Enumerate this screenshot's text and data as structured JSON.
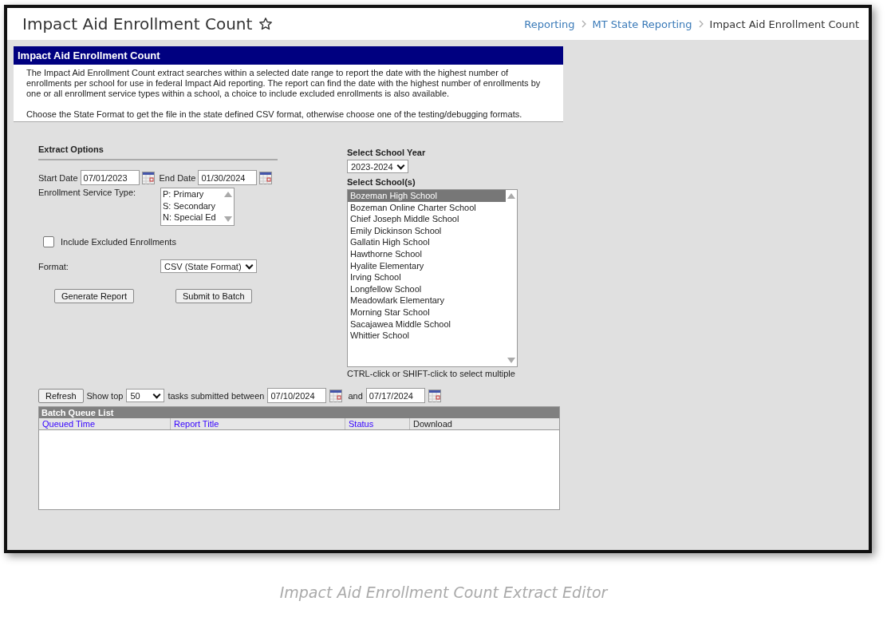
{
  "page_title": "Impact Aid Enrollment Count",
  "breadcrumbs": [
    {
      "label": "Reporting",
      "link": true
    },
    {
      "label": "MT State Reporting",
      "link": true
    },
    {
      "label": "Impact Aid Enrollment Count",
      "link": false
    }
  ],
  "panel": {
    "title": "Impact Aid Enrollment Count",
    "description": "The Impact Aid Enrollment Count extract searches within a selected date range to report the date with the highest number of enrollments per school for use in federal Impact Aid reporting. The report can find the date with the highest number of enrollments by one or all enrollment service types within a school, a choice to include excluded enrollments is also available.",
    "note": "Choose the State Format to get the file in the state defined CSV format, otherwise choose one of the testing/debugging formats."
  },
  "extract_options": {
    "heading": "Extract Options",
    "start_date_label": "Start Date",
    "start_date": "07/01/2023",
    "end_date_label": "End Date",
    "end_date": "01/30/2024",
    "service_type_label": "Enrollment Service Type:",
    "service_types": [
      {
        "label": "P: Primary",
        "selected": false
      },
      {
        "label": "S: Secondary",
        "selected": false
      },
      {
        "label": "N: Special Ed",
        "selected": false
      }
    ],
    "include_excluded": {
      "label": "Include Excluded Enrollments",
      "checked": false
    },
    "format_label": "Format:",
    "format": "CSV (State Format)",
    "buttons": [
      "Generate Report",
      "Submit to Batch"
    ]
  },
  "school_selection": {
    "year_label": "Select School Year",
    "year": "2023-2024",
    "schools_label": "Select School(s)",
    "schools": [
      {
        "name": "Bozeman High School",
        "selected": true
      },
      {
        "name": "Bozeman Online Charter School",
        "selected": false
      },
      {
        "name": "Chief Joseph Middle School",
        "selected": false
      },
      {
        "name": "Emily Dickinson School",
        "selected": false
      },
      {
        "name": "Gallatin High School",
        "selected": false
      },
      {
        "name": "Hawthorne School",
        "selected": false
      },
      {
        "name": "Hyalite Elementary",
        "selected": false
      },
      {
        "name": "Irving School",
        "selected": false
      },
      {
        "name": "Longfellow School",
        "selected": false
      },
      {
        "name": "Meadowlark Elementary",
        "selected": false
      },
      {
        "name": "Morning Star School",
        "selected": false
      },
      {
        "name": "Sacajawea Middle School",
        "selected": false
      },
      {
        "name": "Whittier School",
        "selected": false
      }
    ],
    "hint": "CTRL-click or SHIFT-click to select multiple"
  },
  "batch": {
    "refresh": "Refresh",
    "show_top": "Show top",
    "top_count": "50",
    "between": "tasks submitted between",
    "from": "07/10/2024",
    "and": "and",
    "to": "07/17/2024",
    "list_title": "Batch Queue List",
    "columns": [
      {
        "label": "Queued Time",
        "sortable": true
      },
      {
        "label": "Report Title",
        "sortable": true
      },
      {
        "label": "Status",
        "sortable": true
      },
      {
        "label": "Download",
        "sortable": false
      }
    ]
  },
  "caption": "Impact Aid Enrollment Count Extract Editor"
}
